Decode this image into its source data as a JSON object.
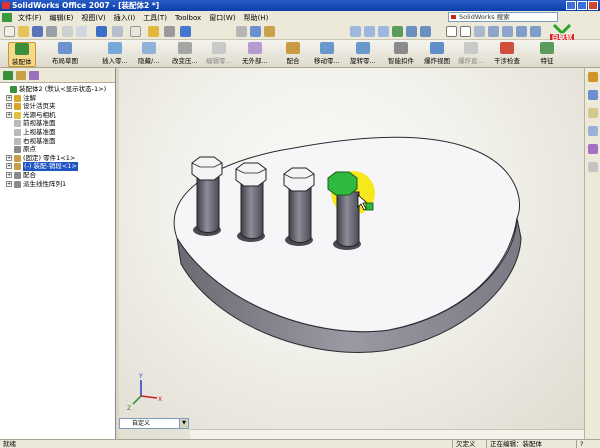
{
  "window": {
    "title": "SolidWorks Office 2007 - [装配体2 *]"
  },
  "menu": [
    "文件(F)",
    "编辑(E)",
    "视图(V)",
    "插入(I)",
    "工具(T)",
    "Toolbox",
    "窗口(W)",
    "帮助(H)"
  ],
  "search": {
    "placeholder": "SolidWorks 搜索"
  },
  "logo": {
    "text": "百联软件"
  },
  "command_manager": {
    "items": [
      "装配体",
      "布局草图",
      "插入零...",
      "隐藏/...",
      "改变压...",
      "编辑零...",
      "无外部...",
      "配合",
      "移动零...",
      "旋转零...",
      "智能扣件",
      "爆炸视图",
      "爆炸直...",
      "干涉检查",
      "特征"
    ]
  },
  "tree": {
    "nodes": [
      {
        "label": "装配体2 (默认<显示状态-1>)",
        "level": 0,
        "icon": "assembly-icon"
      },
      {
        "label": "注解",
        "level": 1,
        "icon": "annotation-icon"
      },
      {
        "label": "设计活页夹",
        "level": 1,
        "icon": "binder-icon"
      },
      {
        "label": "光源与相机",
        "level": 1,
        "icon": "light-icon"
      },
      {
        "label": "前视基准面",
        "level": 1,
        "icon": "plane-icon"
      },
      {
        "label": "上视基准面",
        "level": 1,
        "icon": "plane-icon"
      },
      {
        "label": "右视基准面",
        "level": 1,
        "icon": "plane-icon"
      },
      {
        "label": "原点",
        "level": 1,
        "icon": "origin-icon"
      },
      {
        "label": "(固定) 零件1<1>",
        "level": 1,
        "icon": "part-icon"
      },
      {
        "label": "(-) 装配-销段<1>",
        "level": 1,
        "icon": "part-icon",
        "selected": true
      },
      {
        "label": "配合",
        "level": 1,
        "icon": "mate-icon"
      },
      {
        "label": "派生线性阵列1",
        "level": 1,
        "icon": "pattern-icon"
      }
    ]
  },
  "config": {
    "value": "自定义"
  },
  "status": {
    "left": "就绪",
    "cells": [
      "欠定义",
      "正在编辑：装配体",
      "?"
    ]
  },
  "colors": {
    "accent": "#2255c4",
    "selected_face": "#2fba3f",
    "highlight": "#f5e60a"
  }
}
